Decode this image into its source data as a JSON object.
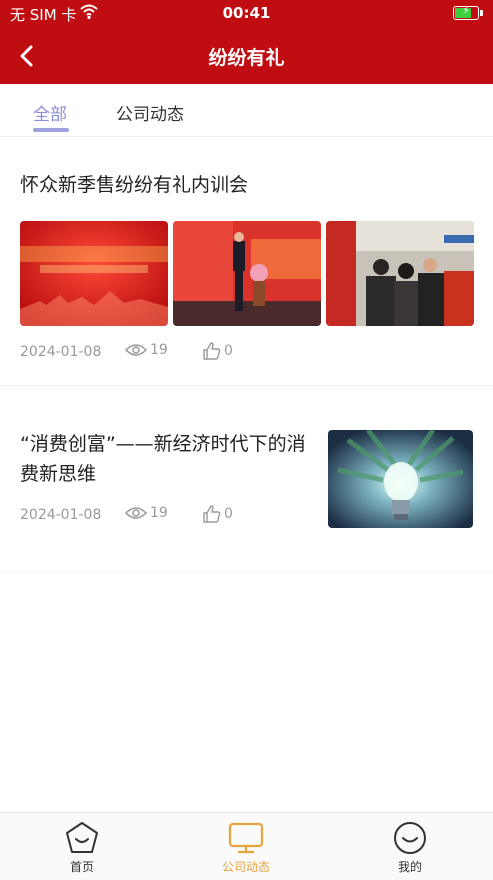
{
  "status_bar": {
    "carrier": "无 SIM 卡",
    "time": "00:41",
    "battery_level": 0.75
  },
  "nav": {
    "title": "纷纷有礼"
  },
  "tabs": [
    {
      "label": "全部",
      "active": true
    },
    {
      "label": "公司动态",
      "active": false
    }
  ],
  "articles": [
    {
      "title": "怀众新季售纷纷有礼内训会",
      "date": "2024-01-08",
      "views": "19",
      "likes": "0",
      "images": [
        "banner-photo",
        "speaker-on-stage-photo",
        "crowd-photo"
      ]
    },
    {
      "title": "“消费创富”——新经济时代下的消费新思维",
      "date": "2024-01-08",
      "views": "19",
      "likes": "0",
      "images": [
        "lightbulb-money-photo"
      ]
    }
  ],
  "bottom_tabs": [
    {
      "label": "首页",
      "icon": "home-face-icon",
      "active": false
    },
    {
      "label": "公司动态",
      "icon": "monitor-icon",
      "active": true
    },
    {
      "label": "我的",
      "icon": "smile-face-icon",
      "active": false
    }
  ],
  "colors": {
    "brand_red": "#c00d12",
    "tab_active": "#8a8dd8",
    "bottom_active": "#e8a33d"
  }
}
